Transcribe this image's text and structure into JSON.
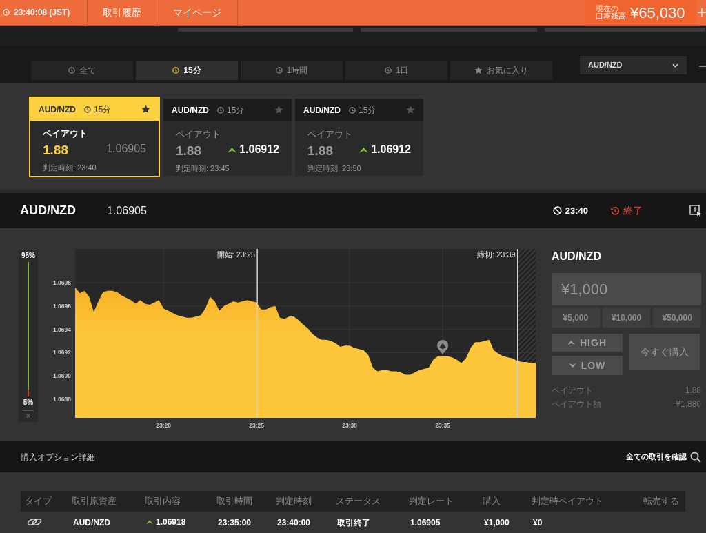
{
  "header": {
    "clock": "23:40:08 (JST)",
    "nav": [
      "取引履歴",
      "マイページ"
    ],
    "balance_label": [
      "現在の",
      "口座残高"
    ],
    "balance": "¥65,030"
  },
  "filter_tabs": [
    {
      "kind": "period",
      "label": "全て",
      "selected": false
    },
    {
      "kind": "period",
      "label": "15分",
      "selected": true
    },
    {
      "kind": "period",
      "label": "1時間",
      "selected": false
    },
    {
      "kind": "period",
      "label": "1日",
      "selected": false
    },
    {
      "kind": "favorites",
      "label": "お気に入り",
      "selected": false
    }
  ],
  "pair_select": {
    "value": "AUD/NZD"
  },
  "options": [
    {
      "pair": "AUD/NZD",
      "duration": "15分",
      "selected": true,
      "payout_label": "ペイアウト",
      "payout": "1.88",
      "rising": false,
      "rate": "1.06905",
      "deadline": "判定時刻: 23:40"
    },
    {
      "pair": "AUD/NZD",
      "duration": "15分",
      "selected": false,
      "payout_label": "ペイアウト",
      "payout": "1.88",
      "rising": true,
      "rate": "1.06912",
      "deadline": "判定時刻: 23:45"
    },
    {
      "pair": "AUD/NZD",
      "duration": "15分",
      "selected": false,
      "payout_label": "ペイアウト",
      "payout": "1.88",
      "rising": true,
      "rate": "1.06912",
      "deadline": "判定時刻: 23:50"
    }
  ],
  "price_bar": {
    "pair": "AUD/NZD",
    "rate": "1.06905",
    "deadline": "23:40",
    "status": "終了"
  },
  "sentiment": {
    "high_label": "95%",
    "level": 0.95,
    "low_label": "5%",
    "close": "×"
  },
  "chart": {
    "time_markers": [
      {
        "label": "開始: 23:25"
      },
      {
        "label": "締切: 23:39"
      }
    ],
    "chart_data": {
      "type": "area",
      "grid": true,
      "categories": [
        null,
        null,
        null,
        null,
        null,
        null,
        null,
        null,
        null,
        null,
        null,
        null,
        null,
        null,
        null,
        null,
        null,
        null,
        null,
        "23:20",
        null,
        null,
        null,
        null,
        null,
        null,
        null,
        null,
        null,
        null,
        null,
        null,
        null,
        null,
        null,
        null,
        null,
        null,
        null,
        "23:25",
        null,
        null,
        null,
        null,
        null,
        null,
        null,
        null,
        null,
        null,
        null,
        null,
        null,
        null,
        null,
        null,
        null,
        null,
        null,
        "23:30",
        null,
        null,
        null,
        null,
        null,
        null,
        null,
        null,
        null,
        null,
        null,
        null,
        null,
        null,
        null,
        null,
        null,
        null,
        null,
        "23:35",
        null,
        null,
        null,
        null,
        null,
        null,
        null,
        null,
        null,
        null,
        null,
        null,
        null,
        null,
        null,
        null,
        null,
        null,
        null,
        null
      ],
      "series": [
        {
          "color": "#fec63a",
          "values": [
            1.06976,
            1.06971,
            1.06973,
            1.06968,
            1.06955,
            1.06964,
            1.06972,
            1.06973,
            1.06973,
            1.06972,
            1.06969,
            1.06967,
            1.06965,
            1.06962,
            1.06965,
            1.06962,
            1.06961,
            1.06963,
            1.06965,
            1.06958,
            1.06956,
            1.06954,
            1.06952,
            1.06951,
            1.0695,
            1.0695,
            1.06951,
            1.06952,
            1.06958,
            1.06968,
            1.06964,
            1.06956,
            1.0696,
            1.06962,
            1.06964,
            1.06963,
            1.06964,
            1.06965,
            1.06964,
            1.06963,
            1.06957,
            1.06957,
            1.06959,
            1.0696,
            1.0695,
            1.06949,
            1.06951,
            1.06951,
            1.06948,
            1.06944,
            1.06941,
            1.06936,
            1.06933,
            1.06931,
            1.06931,
            1.0693,
            1.06928,
            1.06925,
            1.06926,
            1.06926,
            1.06924,
            1.06923,
            1.06922,
            1.06918,
            1.06907,
            1.06904,
            1.06905,
            1.06905,
            1.06904,
            1.06904,
            1.06903,
            1.06901,
            1.06901,
            1.06903,
            1.06905,
            1.06906,
            1.06907,
            1.06914,
            1.06917,
            1.06917,
            1.06917,
            1.06916,
            1.06914,
            1.06911,
            1.06915,
            1.06924,
            1.06929,
            1.06929,
            1.0693,
            1.06931,
            1.06922,
            1.06919,
            1.06917,
            1.06916,
            1.06915,
            1.06913,
            1.06912,
            1.06912,
            1.06911,
            1.06911
          ]
        }
      ],
      "ylim": [
        1.06864,
        1.07009
      ],
      "yticks": [
        {
          "value": 1.0688,
          "label": "1.0688"
        },
        {
          "value": 1.069,
          "label": "1.0690"
        },
        {
          "value": 1.0692,
          "label": "1.0692"
        },
        {
          "value": 1.0694,
          "label": "1.0694"
        },
        {
          "value": 1.0696,
          "label": "1.0696"
        },
        {
          "value": 1.0698,
          "label": "1.0698"
        }
      ],
      "annotations": [
        {
          "x": "23:35"
        }
      ]
    }
  },
  "order_panel": {
    "pair": "AUD/NZD",
    "disabled": true,
    "amount": "¥1,000",
    "quick_amounts": [
      "¥5,000",
      "¥10,000",
      "¥50,000"
    ],
    "directions": [
      {
        "kind": "high",
        "label": "HIGH"
      },
      {
        "kind": "low",
        "label": "LOW"
      }
    ],
    "buy": "今すぐ購入",
    "summary": [
      {
        "label": "ペイアウト",
        "value": "1.88"
      },
      {
        "label": "ペイアウト額",
        "value": "¥1,880"
      }
    ]
  },
  "details": {
    "title": "購入オプション詳細",
    "link": "全ての取引を確認",
    "table": {
      "columns": [
        "タイプ",
        "取引原資産",
        "取引内容",
        "取引時間",
        "判定時刻",
        "ステータス",
        "判定レート",
        "購入",
        "判定時ペイアウト",
        "転売する"
      ],
      "rows": [
        {
          "asset": "AUD/NZD",
          "high": true,
          "entry_rate": "1.06918",
          "trade_time": "23:35:00",
          "expiry_time": "23:40:00",
          "status": "取引終了",
          "closing_rate": "1.06905",
          "amount": "¥1,000",
          "payout": "¥0"
        }
      ]
    }
  }
}
